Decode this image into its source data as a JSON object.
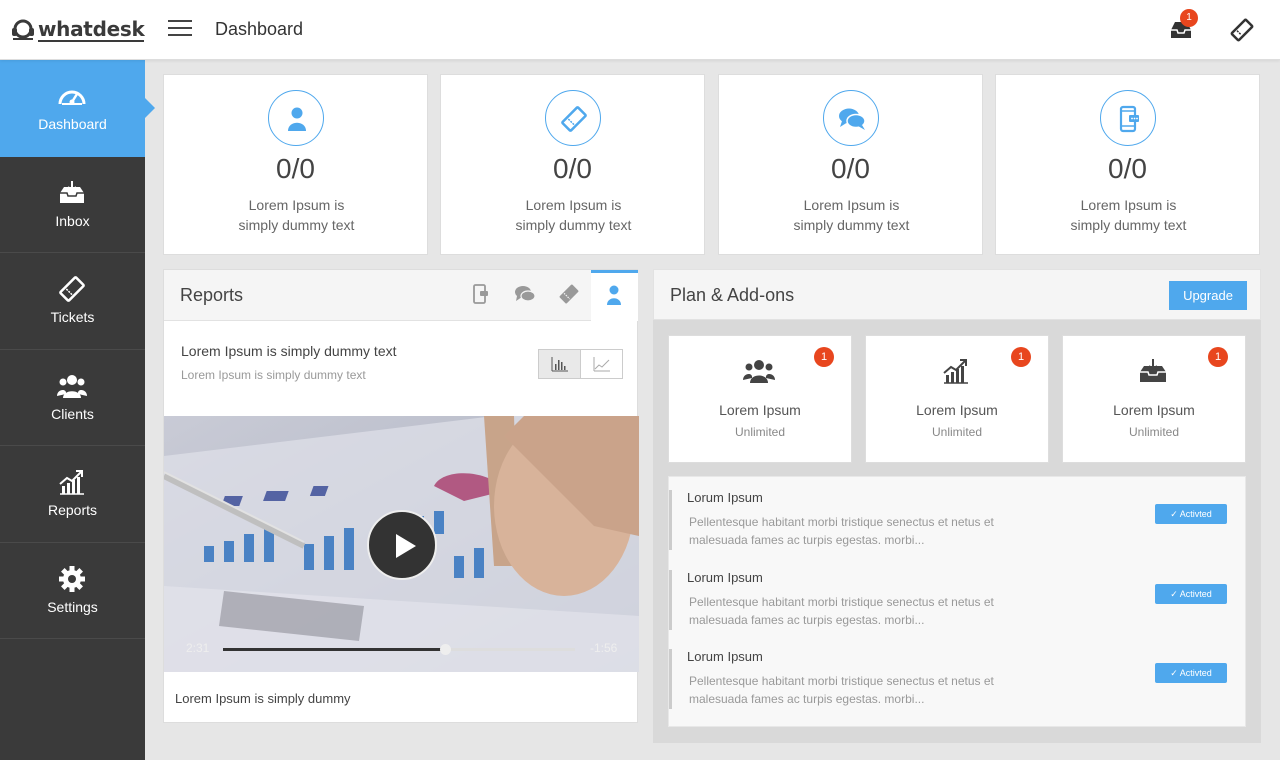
{
  "app": {
    "logo_text": "whatdesk"
  },
  "header": {
    "title": "Dashboard",
    "inbox_badge": "1"
  },
  "sidebar": {
    "items": [
      {
        "label": "Dashboard",
        "icon": "speedometer-icon",
        "active": true
      },
      {
        "label": "Inbox",
        "icon": "inbox-icon"
      },
      {
        "label": "Tickets",
        "icon": "ticket-icon"
      },
      {
        "label": "Clients",
        "icon": "users-icon"
      },
      {
        "label": "Reports",
        "icon": "chart-icon"
      },
      {
        "label": "Settings",
        "icon": "gear-icon"
      }
    ]
  },
  "stats": [
    {
      "value": "0/0",
      "line1": "Lorem Ipsum is",
      "line2": "simply dummy text",
      "icon": "user-icon"
    },
    {
      "value": "0/0",
      "line1": "Lorem Ipsum is",
      "line2": "simply dummy text",
      "icon": "ticket-icon"
    },
    {
      "value": "0/0",
      "line1": "Lorem Ipsum is",
      "line2": "simply dummy text",
      "icon": "chat-icon"
    },
    {
      "value": "0/0",
      "line1": "Lorem Ipsum is",
      "line2": "simply dummy text",
      "icon": "mobile-icon"
    }
  ],
  "reports": {
    "title": "Reports",
    "main_text": "Lorem Ipsum is simply dummy text",
    "sub_text": "Lorem Ipsum is simply dummy text",
    "video": {
      "time_elapsed": "2:31",
      "time_remaining": "-1:56",
      "progress": 0.63
    },
    "caption": "Lorem Ipsum is simply dummy"
  },
  "plan": {
    "title": "Plan & Add-ons",
    "upgrade_label": "Upgrade",
    "addons": [
      {
        "name": "Lorem Ipsum",
        "value": "Unlimited",
        "badge": "1",
        "icon": "users-icon"
      },
      {
        "name": "Lorem Ipsum",
        "value": "Unlimited",
        "badge": "1",
        "icon": "chart-icon"
      },
      {
        "name": "Lorem Ipsum",
        "value": "Unlimited",
        "badge": "1",
        "icon": "inbox-icon"
      }
    ],
    "items": [
      {
        "title": "Lorum Ipsum",
        "desc": "Pellentesque habitant morbi tristique senectus et netus et malesuada fames ac turpis egestas. morbi...",
        "status": "Activted"
      },
      {
        "title": "Lorum Ipsum",
        "desc": "Pellentesque habitant morbi tristique senectus et netus et malesuada fames ac turpis egestas. morbi...",
        "status": "Activted"
      },
      {
        "title": "Lorum Ipsum",
        "desc": "Pellentesque habitant morbi tristique senectus et netus et malesuada fames ac turpis egestas. morbi...",
        "status": "Activted"
      }
    ]
  },
  "colors": {
    "accent": "#4fa8ed",
    "sidebar_bg": "#3a3a3a",
    "badge": "#e8461e"
  }
}
